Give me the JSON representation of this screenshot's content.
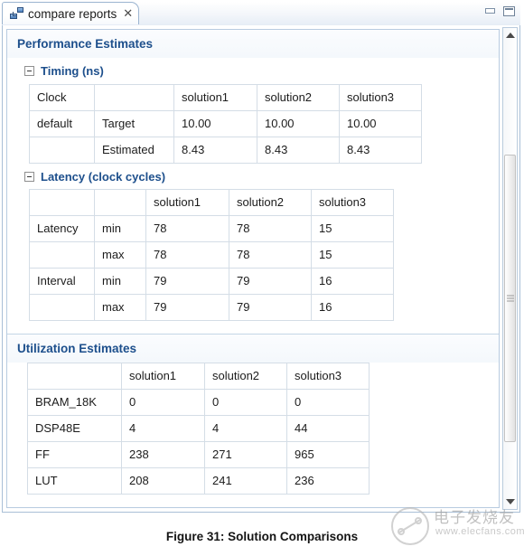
{
  "window": {
    "tab": {
      "label": "compare reports",
      "close_glyph": "✕",
      "icon": "compare-reports-icon"
    },
    "controls": {
      "minimize_label": "Minimize",
      "maximize_label": "Maximize"
    },
    "scrollbar": {
      "up_arrow": "▲",
      "down_arrow": "▼"
    }
  },
  "report": {
    "performance": {
      "title": "Performance Estimates",
      "timing": {
        "title": "Timing (ns)",
        "rows": [
          [
            "Clock",
            "",
            "solution1",
            "solution2",
            "solution3"
          ],
          [
            "default",
            "Target",
            "10.00",
            "10.00",
            "10.00"
          ],
          [
            "",
            "Estimated",
            "8.43",
            "8.43",
            "8.43"
          ]
        ]
      },
      "latency": {
        "title": "Latency (clock cycles)",
        "rows": [
          [
            "",
            "",
            "solution1",
            "solution2",
            "solution3"
          ],
          [
            "Latency",
            "min",
            "78",
            "78",
            "15"
          ],
          [
            "",
            "max",
            "78",
            "78",
            "15"
          ],
          [
            "Interval",
            "min",
            "79",
            "79",
            "16"
          ],
          [
            "",
            "max",
            "79",
            "79",
            "16"
          ]
        ]
      }
    },
    "utilization": {
      "title": "Utilization Estimates",
      "rows": [
        [
          "",
          "solution1",
          "solution2",
          "solution3"
        ],
        [
          "BRAM_18K",
          "0",
          "0",
          "0"
        ],
        [
          "DSP48E",
          "4",
          "4",
          "44"
        ],
        [
          "FF",
          "238",
          "271",
          "965"
        ],
        [
          "LUT",
          "208",
          "241",
          "236"
        ]
      ]
    }
  },
  "caption": "Figure 31:  Solution Comparisons",
  "watermark": {
    "text_cn": "电子发烧友",
    "url": "www.elecfans.com"
  },
  "colors": {
    "heading_blue": "#1d4f8c",
    "frame_blue": "#a9bfd6",
    "table_border": "#d4dde6"
  }
}
